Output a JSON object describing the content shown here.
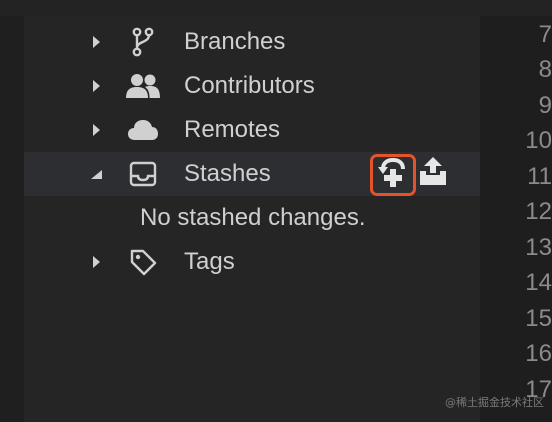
{
  "sidebar": {
    "items": [
      {
        "label": "Branches",
        "icon": "branch-icon",
        "expanded": false
      },
      {
        "label": "Contributors",
        "icon": "people-icon",
        "expanded": false
      },
      {
        "label": "Remotes",
        "icon": "cloud-icon",
        "expanded": false
      },
      {
        "label": "Stashes",
        "icon": "inbox-icon",
        "expanded": true,
        "empty_text": "No stashed changes."
      },
      {
        "label": "Tags",
        "icon": "tag-icon",
        "expanded": false
      }
    ],
    "stash_actions": {
      "stash": "stash-save-icon",
      "apply": "stash-apply-icon"
    }
  },
  "editor": {
    "line_numbers": [
      "7",
      "8",
      "9",
      "10",
      "11",
      "12",
      "13",
      "14",
      "15",
      "16",
      "17"
    ]
  },
  "watermark": "@稀土掘金技术社区",
  "colors": {
    "panel_bg": "#252526",
    "active_row_bg": "#2c2e31",
    "text": "#d0d0d0",
    "highlight": "#e5532a"
  }
}
